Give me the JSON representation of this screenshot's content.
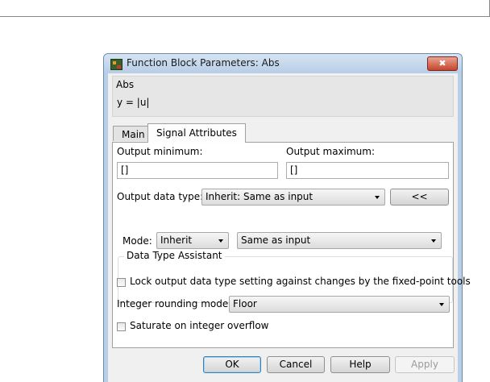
{
  "window": {
    "title": "Function Block Parameters: Abs",
    "close_label": "✖"
  },
  "block": {
    "name": "Abs",
    "description": "y = |u|"
  },
  "tabs": [
    {
      "label": "Main",
      "active": false
    },
    {
      "label": "Signal Attributes",
      "active": true
    }
  ],
  "signal": {
    "output_min_label": "Output minimum:",
    "output_min_value": "[]",
    "output_max_label": "Output maximum:",
    "output_max_value": "[]",
    "output_type_label": "Output data type:",
    "output_type_value": "Inherit: Same as input",
    "assistant_toggle_label": "<<",
    "assistant": {
      "title": "Data Type Assistant",
      "mode_label": "Mode:",
      "mode_value": "Inherit",
      "rule_value": "Same as input"
    },
    "lock_label": "Lock output data type setting against changes by the fixed-point tools",
    "lock_checked": false,
    "rounding_label": "Integer rounding mode:",
    "rounding_value": "Floor",
    "saturate_label": "Saturate on integer overflow",
    "saturate_checked": false
  },
  "buttons": {
    "ok": "OK",
    "cancel": "Cancel",
    "help": "Help",
    "apply": "Apply"
  }
}
